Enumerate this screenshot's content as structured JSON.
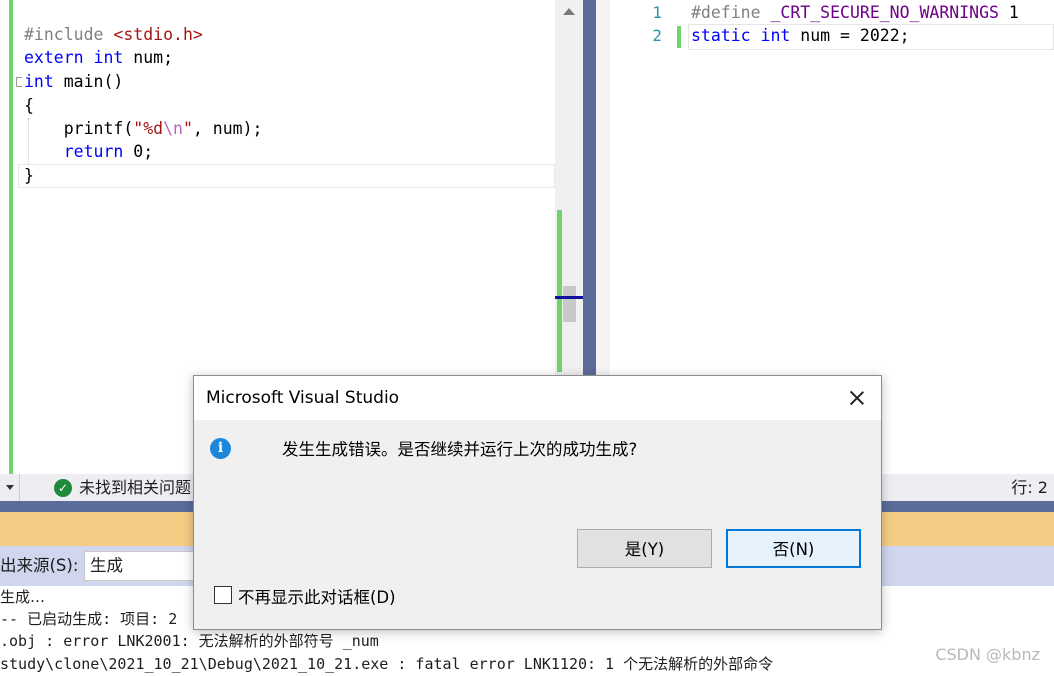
{
  "left_editor": {
    "lines": [
      {
        "pp": "#include ",
        "str": "<stdio.h>"
      },
      {
        "kw": "extern",
        "sp": " ",
        "kw2": "int",
        "rest": " num;"
      },
      {
        "kw": "int",
        "rest": " main()"
      },
      {
        "rest": "{"
      },
      {
        "fn": "    printf(",
        "str1": "\"%d",
        "esc": "\\n",
        "str2": "\"",
        "rest": ", num);"
      },
      {
        "kw": "    return",
        "rest": " 0;"
      },
      {
        "rest": "}"
      }
    ]
  },
  "right_editor": {
    "line_numbers": [
      "1",
      "2"
    ],
    "line1": {
      "pp": "#define",
      "macro": " _CRT_SECURE_NO_WARNINGS",
      "rest": " 1"
    },
    "line2": {
      "kw": "static",
      "kw2": "int",
      "rest": " num = 2022;"
    }
  },
  "status_bar": {
    "issues_text": "未找到相关问题",
    "line_indicator": "行: 2"
  },
  "output": {
    "source_label": "出来源(S):",
    "source_value": "生成",
    "lines": [
      "生成…",
      "-- 已启动生成: 项目: 2",
      ".obj : error LNK2001: 无法解析的外部符号 _num",
      "study\\clone\\2021_10_21\\Debug\\2021_10_21.exe : fatal error LNK1120: 1 个无法解析的外部命令"
    ]
  },
  "dialog": {
    "title": "Microsoft Visual Studio",
    "message": "发生生成错误。是否继续并运行上次的成功生成?",
    "yes_label": "是(Y)",
    "no_label": "否(N)",
    "checkbox_label": "不再显示此对话框(D)",
    "icon": "info-icon"
  },
  "watermark": "CSDN @kbnz",
  "colors": {
    "keyword": "#0000ff",
    "preprocessor": "#808080",
    "string": "#a31515",
    "macro": "#6f008a",
    "change_bar": "#6fd36f",
    "accent": "#0078d7"
  }
}
